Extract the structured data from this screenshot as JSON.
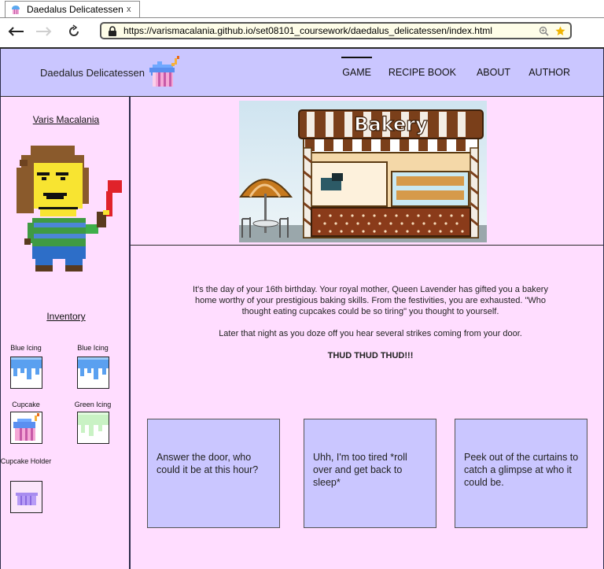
{
  "browser": {
    "tab_title": "Daedalus Delicatessen",
    "tab_close": "x",
    "url": "https://varismacalania.github.io/set08101_coursework/daedalus_delicatessen/index.html"
  },
  "site": {
    "brand": "Daedalus Delicatessen",
    "nav": [
      {
        "label": "GAME",
        "active": true
      },
      {
        "label": "RECIPE BOOK",
        "active": false
      },
      {
        "label": "ABOUT",
        "active": false
      },
      {
        "label": "AUTHOR",
        "active": false
      }
    ]
  },
  "sidebar": {
    "username": "Varis Macalania",
    "inventory_title": "Inventory",
    "items": [
      {
        "label": "Blue Icing",
        "icon": "blue-icing-icon"
      },
      {
        "label": "Blue Icing",
        "icon": "blue-icing-icon"
      },
      {
        "label": "Cupcake",
        "icon": "cupcake-icon"
      },
      {
        "label": "Green Icing",
        "icon": "green-icing-icon"
      },
      {
        "label": "Cupcake Holder",
        "icon": "cupcake-holder-icon"
      }
    ]
  },
  "scene": {
    "sign_text": "Bakery"
  },
  "story": {
    "paragraph1": "It's the day of your 16th birthday. Your royal mother, Queen Lavender has gifted you a bakery home worthy of your prestigious baking skills. From the festivities, you are exhausted. \"Who thought eating cupcakes could be so tiring\" you thought to yourself.",
    "paragraph2": "Later that night as you doze off you hear several strikes coming from your door.",
    "shout": "THUD THUD THUD!!!"
  },
  "choices": [
    {
      "text": "Answer the door, who could it be at this hour?"
    },
    {
      "text": "Uhh, I'm too tired *roll over and get back to sleep*"
    },
    {
      "text": "Peek out of the curtains to catch a glimpse at who it could be."
    }
  ],
  "colors": {
    "header_bg": "#cac6ff",
    "page_bg": "#ffddff",
    "choice_bg": "#cac6ff"
  }
}
